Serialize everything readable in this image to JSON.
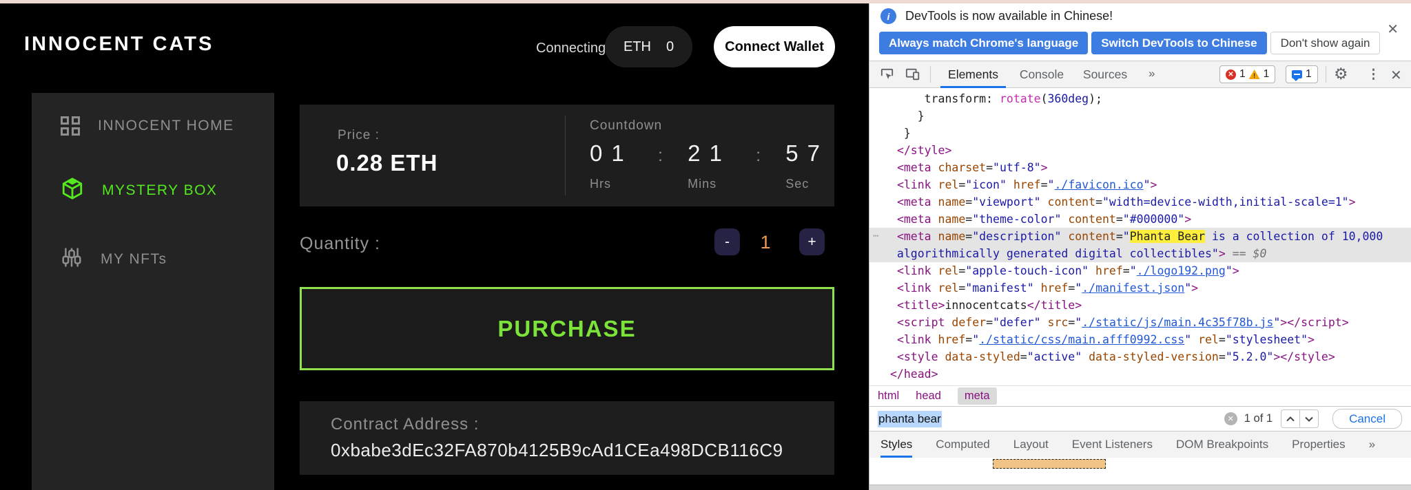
{
  "page": {
    "logo": "INNOCENT CATS",
    "header": {
      "connecting": "Connecting...",
      "eth_label": "ETH",
      "eth_balance": "0",
      "connect_wallet": "Connect Wallet"
    },
    "sidebar": {
      "items": [
        {
          "label": "INNOCENT HOME",
          "icon": "grid-icon",
          "active": false
        },
        {
          "label": "MYSTERY BOX",
          "icon": "cube-icon",
          "active": true
        },
        {
          "label": "MY NFTs",
          "icon": "sliders-icon",
          "active": false
        }
      ]
    },
    "mint": {
      "price_label": "Price :",
      "price_value": "0.28 ETH",
      "countdown_label": "Countdown",
      "countdown": {
        "hrs": "01",
        "mins": "21",
        "secs": "57",
        "hrs_unit": "Hrs",
        "mins_unit": "Mins",
        "secs_unit": "Sec",
        "colon": ":"
      },
      "quantity_label": "Quantity :",
      "quantity_value": "1",
      "minus": "-",
      "plus": "+",
      "purchase_label": "PURCHASE",
      "contract_label": "Contract Address :",
      "contract_address": "0xbabe3dEc32FA870b4125B9cAd1CEa498DCB116C9"
    },
    "colors": {
      "accent_green": "#54e81f",
      "purchase_border": "#8ee24b",
      "quantity_orange": "#ed9853"
    }
  },
  "devtools": {
    "notification": {
      "message": "DevTools is now available in Chinese!",
      "buttons": [
        {
          "label": "Always match Chrome's language",
          "style": "primary"
        },
        {
          "label": "Switch DevTools to Chinese",
          "style": "primary"
        },
        {
          "label": "Don't show again",
          "style": "secondary"
        }
      ]
    },
    "toolbar": {
      "tabs": [
        {
          "label": "Elements",
          "active": true
        },
        {
          "label": "Console",
          "active": false
        },
        {
          "label": "Sources",
          "active": false
        }
      ],
      "more_tabs": "»",
      "error_count": "1",
      "warning_count": "1",
      "warning_mark": "!",
      "issue_count": "1"
    },
    "icons": {
      "close": "✕",
      "gear": "⚙",
      "kebab": "⋮",
      "clear": "✕",
      "info": "i",
      "gutter_more": "⋯"
    },
    "code_lines": [
      {
        "tokens": [
          [
            "     transform: ",
            "pln"
          ],
          [
            "rotate",
            "fn"
          ],
          [
            "(",
            "pln"
          ],
          [
            "360deg",
            "num"
          ],
          [
            ");",
            "pln"
          ]
        ]
      },
      {
        "tokens": [
          [
            "    }",
            "pln"
          ]
        ]
      },
      {
        "tokens": [
          [
            "  }",
            "pln"
          ]
        ]
      },
      {
        "tokens": [
          [
            " ",
            "pln"
          ],
          [
            "</style>",
            "tag"
          ]
        ]
      },
      {
        "tokens": [
          [
            " ",
            "pln"
          ],
          [
            "<meta",
            "tag"
          ],
          [
            " ",
            "pln"
          ],
          [
            "charset",
            "attr"
          ],
          [
            "=",
            "pln"
          ],
          [
            "\"utf-8\"",
            "val"
          ],
          [
            ">",
            "tag"
          ]
        ]
      },
      {
        "tokens": [
          [
            " ",
            "pln"
          ],
          [
            "<link",
            "tag"
          ],
          [
            " ",
            "pln"
          ],
          [
            "rel",
            "attr"
          ],
          [
            "=",
            "pln"
          ],
          [
            "\"icon\"",
            "val"
          ],
          [
            " ",
            "pln"
          ],
          [
            "href",
            "attr"
          ],
          [
            "=",
            "pln"
          ],
          [
            "\"",
            "val"
          ],
          [
            "./favicon.ico",
            "lnk"
          ],
          [
            "\"",
            "val"
          ],
          [
            ">",
            "tag"
          ]
        ]
      },
      {
        "tokens": [
          [
            " ",
            "pln"
          ],
          [
            "<meta",
            "tag"
          ],
          [
            " ",
            "pln"
          ],
          [
            "name",
            "attr"
          ],
          [
            "=",
            "pln"
          ],
          [
            "\"viewport\"",
            "val"
          ],
          [
            " ",
            "pln"
          ],
          [
            "content",
            "attr"
          ],
          [
            "=",
            "pln"
          ],
          [
            "\"width=device-width,initial-scale=1\"",
            "val"
          ],
          [
            ">",
            "tag"
          ]
        ]
      },
      {
        "tokens": [
          [
            " ",
            "pln"
          ],
          [
            "<meta",
            "tag"
          ],
          [
            " ",
            "pln"
          ],
          [
            "name",
            "attr"
          ],
          [
            "=",
            "pln"
          ],
          [
            "\"theme-color\"",
            "val"
          ],
          [
            " ",
            "pln"
          ],
          [
            "content",
            "attr"
          ],
          [
            "=",
            "pln"
          ],
          [
            "\"#000000\"",
            "val"
          ],
          [
            ">",
            "tag"
          ]
        ]
      },
      {
        "selected": true,
        "gutter": "⋯",
        "tokens": [
          [
            " ",
            "pln"
          ],
          [
            "<meta",
            "tag"
          ],
          [
            " ",
            "pln"
          ],
          [
            "name",
            "attr"
          ],
          [
            "=",
            "pln"
          ],
          [
            "\"description\"",
            "val"
          ],
          [
            " ",
            "pln"
          ],
          [
            "content",
            "attr"
          ],
          [
            "=",
            "pln"
          ],
          [
            "\"",
            "val"
          ],
          [
            "Phanta Bear",
            "hl"
          ],
          [
            " is a collection of 10,000",
            "val"
          ]
        ]
      },
      {
        "selected": true,
        "tokens": [
          [
            " algorithmically generated digital collectibles",
            "val"
          ],
          [
            "\"",
            "val"
          ],
          [
            ">",
            "tag"
          ],
          [
            " == ",
            "dim"
          ],
          [
            "$0",
            "dim"
          ]
        ]
      },
      {
        "tokens": [
          [
            " ",
            "pln"
          ],
          [
            "<link",
            "tag"
          ],
          [
            " ",
            "pln"
          ],
          [
            "rel",
            "attr"
          ],
          [
            "=",
            "pln"
          ],
          [
            "\"apple-touch-icon\"",
            "val"
          ],
          [
            " ",
            "pln"
          ],
          [
            "href",
            "attr"
          ],
          [
            "=",
            "pln"
          ],
          [
            "\"",
            "val"
          ],
          [
            "./logo192.png",
            "lnk"
          ],
          [
            "\"",
            "val"
          ],
          [
            ">",
            "tag"
          ]
        ]
      },
      {
        "tokens": [
          [
            " ",
            "pln"
          ],
          [
            "<link",
            "tag"
          ],
          [
            " ",
            "pln"
          ],
          [
            "rel",
            "attr"
          ],
          [
            "=",
            "pln"
          ],
          [
            "\"manifest\"",
            "val"
          ],
          [
            " ",
            "pln"
          ],
          [
            "href",
            "attr"
          ],
          [
            "=",
            "pln"
          ],
          [
            "\"",
            "val"
          ],
          [
            "./manifest.json",
            "lnk"
          ],
          [
            "\"",
            "val"
          ],
          [
            ">",
            "tag"
          ]
        ]
      },
      {
        "tokens": [
          [
            " ",
            "pln"
          ],
          [
            "<title>",
            "tag"
          ],
          [
            "innocentcats",
            "pln"
          ],
          [
            "</title>",
            "tag"
          ]
        ]
      },
      {
        "tokens": [
          [
            " ",
            "pln"
          ],
          [
            "<script",
            "tag"
          ],
          [
            " ",
            "pln"
          ],
          [
            "defer",
            "attr"
          ],
          [
            "=",
            "pln"
          ],
          [
            "\"defer\"",
            "val"
          ],
          [
            " ",
            "pln"
          ],
          [
            "src",
            "attr"
          ],
          [
            "=",
            "pln"
          ],
          [
            "\"",
            "val"
          ],
          [
            "./static/js/main.4c35f78b.js",
            "lnk"
          ],
          [
            "\"",
            "val"
          ],
          [
            ">",
            "tag"
          ],
          [
            "</script>",
            "tag"
          ]
        ]
      },
      {
        "tokens": [
          [
            " ",
            "pln"
          ],
          [
            "<link",
            "tag"
          ],
          [
            " ",
            "pln"
          ],
          [
            "href",
            "attr"
          ],
          [
            "=",
            "pln"
          ],
          [
            "\"",
            "val"
          ],
          [
            "./static/css/main.afff0992.css",
            "lnk"
          ],
          [
            "\"",
            "val"
          ],
          [
            " ",
            "pln"
          ],
          [
            "rel",
            "attr"
          ],
          [
            "=",
            "pln"
          ],
          [
            "\"stylesheet\"",
            "val"
          ],
          [
            ">",
            "tag"
          ]
        ]
      },
      {
        "tokens": [
          [
            " ",
            "pln"
          ],
          [
            "<style",
            "tag"
          ],
          [
            " ",
            "pln"
          ],
          [
            "data-styled",
            "attr"
          ],
          [
            "=",
            "pln"
          ],
          [
            "\"active\"",
            "val"
          ],
          [
            " ",
            "pln"
          ],
          [
            "data-styled-version",
            "attr"
          ],
          [
            "=",
            "pln"
          ],
          [
            "\"5.2.0\"",
            "val"
          ],
          [
            ">",
            "tag"
          ],
          [
            "</style>",
            "tag"
          ]
        ]
      },
      {
        "tokens": [
          [
            "</head>",
            "tag"
          ]
        ]
      }
    ],
    "breadcrumbs": [
      {
        "label": "html",
        "selected": false
      },
      {
        "label": "head",
        "selected": false
      },
      {
        "label": "meta",
        "selected": true
      }
    ],
    "search": {
      "query": "phanta bear",
      "result_count": "1 of 1",
      "cancel_label": "Cancel"
    },
    "panel_tabs": [
      {
        "label": "Styles",
        "active": true
      },
      {
        "label": "Computed",
        "active": false
      },
      {
        "label": "Layout",
        "active": false
      },
      {
        "label": "Event Listeners",
        "active": false
      },
      {
        "label": "DOM Breakpoints",
        "active": false
      },
      {
        "label": "Properties",
        "active": false
      }
    ],
    "panel_more_tabs": "»"
  }
}
